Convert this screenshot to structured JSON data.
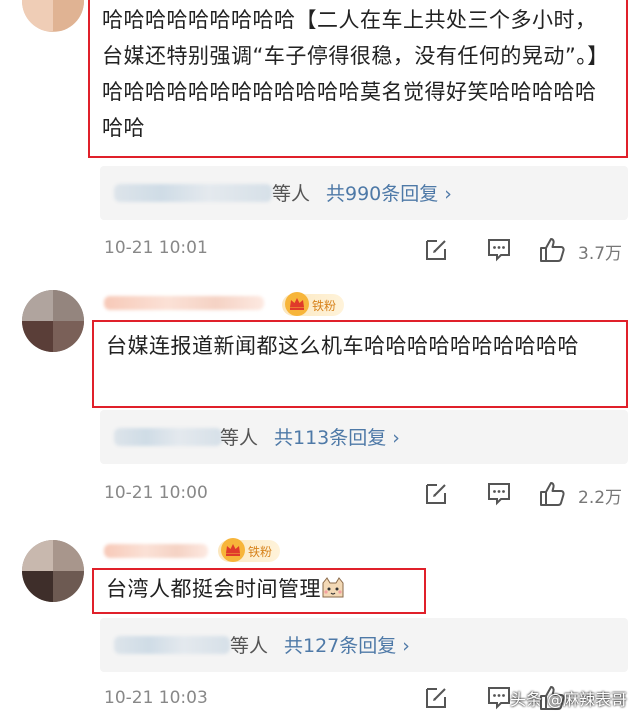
{
  "comments": [
    {
      "text": "哈哈哈哈哈哈哈哈哈【二人在车上共处三个多小时，台媒还特别强调“车子停得很稳，没有任何的晃动”。】哈哈哈哈哈哈哈哈哈哈哈哈莫名觉得好笑哈哈哈哈哈哈哈",
      "reply_etc": "等人",
      "reply_count": "共990条回复 ›",
      "time": "10-21 10:01",
      "likes": "3.7万"
    },
    {
      "badge": "铁粉",
      "text": "台媒连报道新闻都这么机车哈哈哈哈哈哈哈哈哈哈",
      "reply_etc": "等人",
      "reply_count": "共113条回复 ›",
      "time": "10-21 10:00",
      "likes": "2.2万"
    },
    {
      "badge": "铁粉",
      "text": "台湾人都挺会时间管理",
      "emoji": "cat-face-emoji",
      "reply_etc": "等人",
      "reply_count": "共127条回复 ›",
      "time": "10-21 10:03",
      "likes": ""
    }
  ],
  "watermark": "头条 @麻辣表哥",
  "colors": {
    "highlight_border": "#e0202a",
    "reply_link": "#4e79a7",
    "badge_text": "#d7831d"
  },
  "icons": [
    "edit-icon",
    "comment-icon",
    "like-icon",
    "crown-icon"
  ]
}
